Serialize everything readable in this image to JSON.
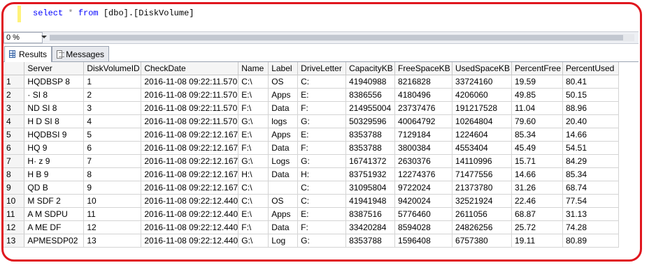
{
  "editor": {
    "query": {
      "kw1": "select",
      "star": "*",
      "kw2": "from",
      "table": "[dbo].[DiskVolume]"
    }
  },
  "zoom": {
    "value": "0 %"
  },
  "tabs": [
    {
      "label": "Results",
      "icon": "grid-icon",
      "active": true
    },
    {
      "label": "Messages",
      "icon": "messages-icon",
      "active": false
    }
  ],
  "grid": {
    "columns": [
      "",
      "Server",
      "DiskVolumeID",
      "CheckDate",
      "Name",
      "Label",
      "DriveLetter",
      "CapacityKB",
      "FreeSpaceKB",
      "UsedSpaceKB",
      "PercentFree",
      "PercentUsed"
    ],
    "rows": [
      [
        "1",
        "HQDBSP  8",
        "1",
        "2016-11-08 09:22:11.570",
        "C:\\",
        "OS",
        "C:",
        "41940988",
        "8216828",
        "33724160",
        "19.59",
        "80.41"
      ],
      [
        "2",
        "   ·  SI  8",
        "2",
        "2016-11-08 09:22:11.570",
        "E:\\",
        "Apps",
        "E:",
        "8386556",
        "4180496",
        "4206060",
        "49.85",
        "50.15"
      ],
      [
        "3",
        "  ND  SI  8",
        "3",
        "2016-11-08 09:22:11.570",
        "F:\\",
        "Data",
        "F:",
        "214955004",
        "23737476",
        "191217528",
        "11.04",
        "88.96"
      ],
      [
        "4",
        "H  D  SI  8",
        "4",
        "2016-11-08 09:22:11.570",
        "G:\\",
        "logs",
        "G:",
        "50329596",
        "40064792",
        "10264804",
        "79.60",
        "20.40"
      ],
      [
        "5",
        "HQDBSI  9",
        "5",
        "2016-11-08 09:22:12.167",
        "E:\\",
        "Apps",
        "E:",
        "8353788",
        "7129184",
        "1224604",
        "85.34",
        "14.66"
      ],
      [
        "6",
        "HQ      9",
        "6",
        "2016-11-08 09:22:12.167",
        "F:\\",
        "Data",
        "F:",
        "8353788",
        "3800384",
        "4553404",
        "45.49",
        "54.51"
      ],
      [
        "7",
        "H·  z   9",
        "7",
        "2016-11-08 09:22:12.167",
        "G:\\",
        "Logs",
        "G:",
        "16741372",
        "2630376",
        "14110996",
        "15.71",
        "84.29"
      ],
      [
        "8",
        "H   B   9",
        "8",
        "2016-11-08 09:22:12.167",
        "H:\\",
        "Data",
        "H:",
        "83751932",
        "12274376",
        "71477556",
        "14.66",
        "85.34"
      ],
      [
        "9",
        "  QD  B   ",
        "9",
        "2016-11-08 09:22:12.167",
        "C:\\",
        "",
        "C:",
        "31095804",
        "9722024",
        "21373780",
        "31.26",
        "68.74"
      ],
      [
        "10",
        "  M  SDF  2",
        "10",
        "2016-11-08 09:22:12.440",
        "C:\\",
        "OS",
        "C:",
        "41941948",
        "9420024",
        "32521924",
        "22.46",
        "77.54"
      ],
      [
        "11",
        "A  M  SDPU",
        "11",
        "2016-11-08 09:22:12.440",
        "E:\\",
        "Apps",
        "E:",
        "8387516",
        "5776460",
        "2611056",
        "68.87",
        "31.13"
      ],
      [
        "12",
        "A  ME  DF",
        "12",
        "2016-11-08 09:22:12.440",
        "F:\\",
        "Data",
        "F:",
        "33420284",
        "8594028",
        "24826256",
        "25.72",
        "74.28"
      ],
      [
        "13",
        "APMESDP02",
        "13",
        "2016-11-08 09:22:12.440",
        "G:\\",
        "Log",
        "G:",
        "8353788",
        "1596408",
        "6757380",
        "19.11",
        "80.89"
      ]
    ]
  }
}
